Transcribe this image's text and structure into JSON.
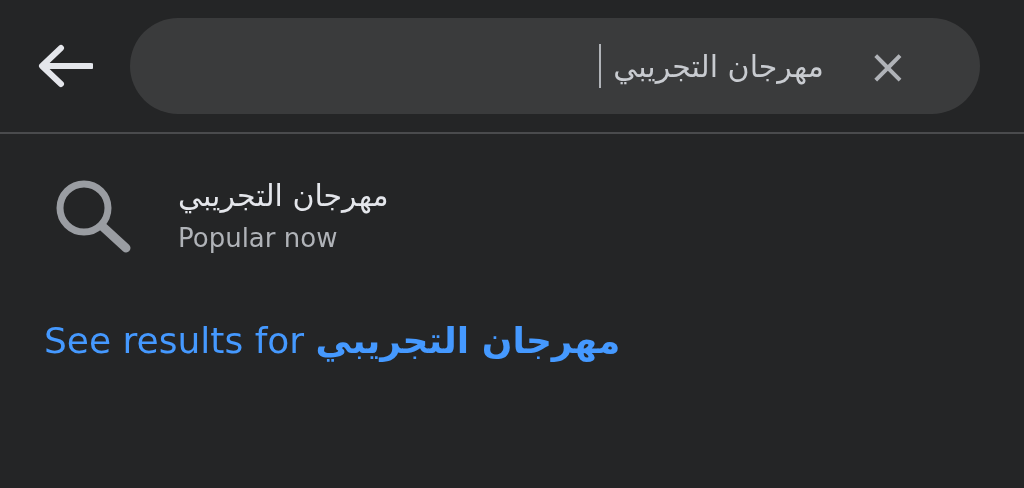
{
  "search": {
    "value": "مهرجان التجريبي",
    "clear_icon": "×"
  },
  "suggestions": [
    {
      "title": "مهرجان التجريبي",
      "subtitle": "Popular now"
    }
  ],
  "see_results": "See results for **مهرجان التجريبي**"
}
